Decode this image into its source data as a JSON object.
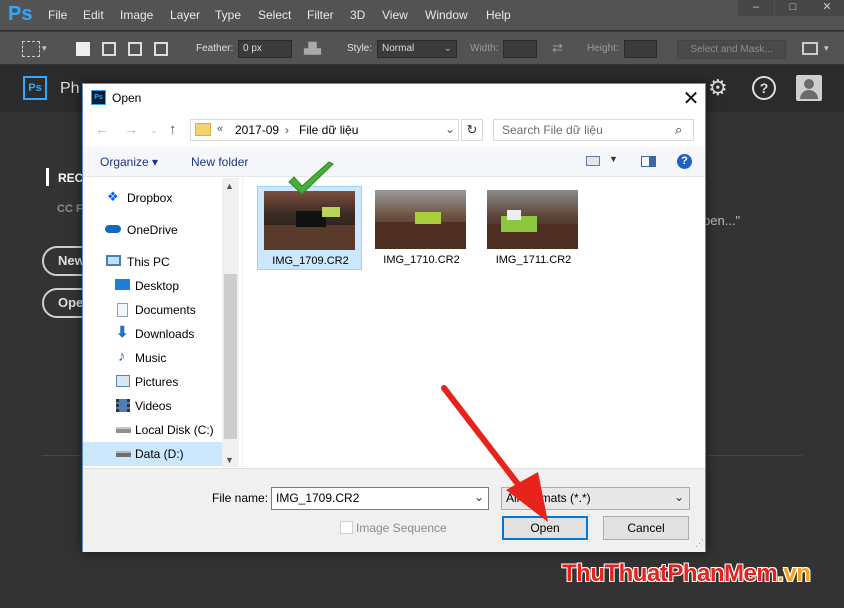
{
  "app": {
    "logo": "Ps",
    "menu": [
      "File",
      "Edit",
      "Image",
      "Layer",
      "Type",
      "Select",
      "Filter",
      "3D",
      "View",
      "Window",
      "Help"
    ],
    "window_controls": [
      "–",
      "□",
      "✕"
    ]
  },
  "options_bar": {
    "feather_label": "Feather:",
    "feather_value": "0 px",
    "style_label": "Style:",
    "style_value": "Normal",
    "width_label": "Width:",
    "height_label": "Height:",
    "select_mask_label": "Select and Mask..."
  },
  "workspace": {
    "ps_badge": "Ps",
    "title": "Ph",
    "recent_label": "REC",
    "cc_label": "CC F",
    "new_button": "New",
    "open_button": "Ope",
    "open_hint": "pen...\""
  },
  "dialog": {
    "title": "Open",
    "ps_icon": "Ps",
    "close": "✕",
    "breadcrumb": [
      "«",
      "2017-09",
      "›",
      "File dữ liệu"
    ],
    "search_placeholder": "Search File dữ liệu",
    "organize_label": "Organize ▾",
    "new_folder_label": "New folder",
    "help_label": "?",
    "nav_items": [
      {
        "label": "Dropbox",
        "icon": "dropbox-icon"
      },
      {
        "label": "OneDrive",
        "icon": "onedrive-icon"
      },
      {
        "label": "This PC",
        "icon": "computer-icon"
      },
      {
        "label": "Desktop",
        "icon": "desktop-icon"
      },
      {
        "label": "Documents",
        "icon": "documents-icon"
      },
      {
        "label": "Downloads",
        "icon": "downloads-icon"
      },
      {
        "label": "Music",
        "icon": "music-icon"
      },
      {
        "label": "Pictures",
        "icon": "pictures-icon"
      },
      {
        "label": "Videos",
        "icon": "videos-icon"
      },
      {
        "label": "Local Disk (C:)",
        "icon": "local-disk-icon"
      },
      {
        "label": "Data (D:)",
        "icon": "drive-icon",
        "selected": true
      }
    ],
    "files": [
      {
        "name": "IMG_1709.CR2",
        "selected": true
      },
      {
        "name": "IMG_1710.CR2",
        "selected": false
      },
      {
        "name": "IMG_1711.CR2",
        "selected": false
      }
    ],
    "file_name_label": "File name:",
    "file_name_value": "IMG_1709.CR2",
    "format_value": "All Formats (*.*)",
    "image_sequence_label": "Image Sequence",
    "open_button": "Open",
    "cancel_button": "Cancel"
  },
  "watermark": {
    "part1": "ThuThuat",
    "part2": "PhanMem",
    "part3": ".vn"
  },
  "colors": {
    "ps_blue": "#31a8ff",
    "selection": "#cce8ff",
    "arrow_red": "#e8231b",
    "check_green": "#45b035"
  }
}
